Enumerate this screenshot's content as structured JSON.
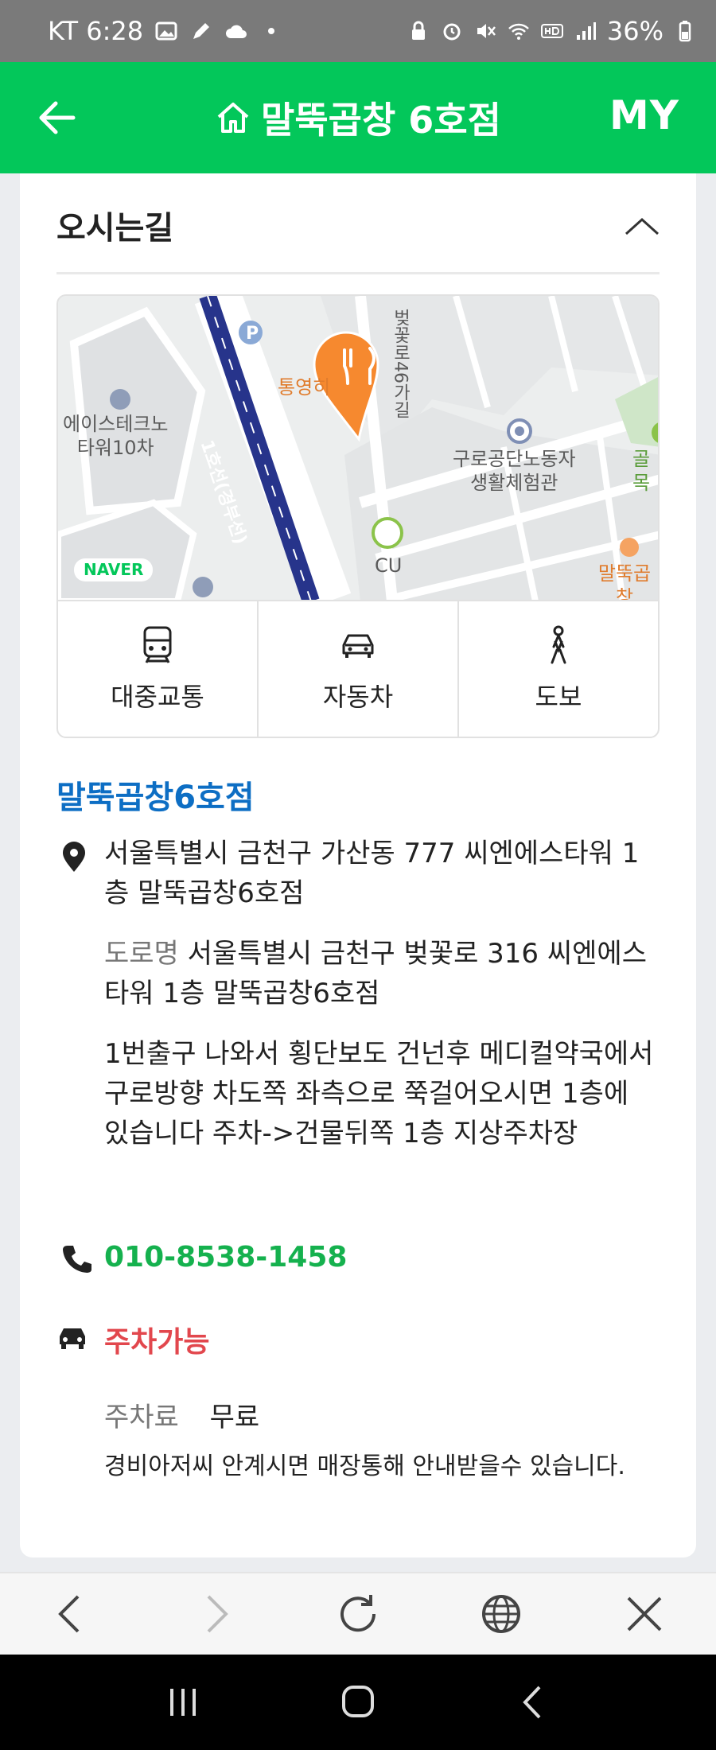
{
  "status_bar": {
    "carrier_time": "KT 6:28",
    "battery": "36%"
  },
  "header": {
    "title": "말뚝곱창 6호점",
    "my_label": "MY"
  },
  "directions": {
    "title": "오시는길",
    "map_labels": {
      "road": "벚꽃로46가길",
      "line": "1호선(경부선)",
      "tongyeong": "통영히",
      "building": "에이스테크노\n타워10차",
      "hall": "구로공단노동자\n생활체험관",
      "golmok": "골목",
      "cu": "CU",
      "malttuk": "말뚝곱창",
      "naver": "NAVER"
    },
    "transport": [
      {
        "label": "대중교통",
        "icon": "bus-icon"
      },
      {
        "label": "자동차",
        "icon": "car-icon"
      },
      {
        "label": "도보",
        "icon": "walk-icon"
      }
    ]
  },
  "place": {
    "name": "말뚝곱창6호점",
    "address": "서울특별시 금천구 가산동 777 씨엔에스타워 1층 말뚝곱창6호점",
    "road_label": "도로명",
    "road_address": "서울특별시 금천구 벚꽃로 316 씨엔에스타워 1층 말뚝곱창6호점",
    "directions_text": "1번출구 나와서 횡단보도 건넌후 메디컬약국에서 구로방향 차도쪽 좌측으로 쭉걸어오시면 1층에 있습니다 주차->건물뒤쪽 1층 지상주차장",
    "phone": "010-8538-1458",
    "parking": "주차가능",
    "fee_label": "주차료",
    "fee_value": "무료",
    "parking_note": "경비아저씨 안계시면 매장통해 안내받을수 있습니다."
  }
}
